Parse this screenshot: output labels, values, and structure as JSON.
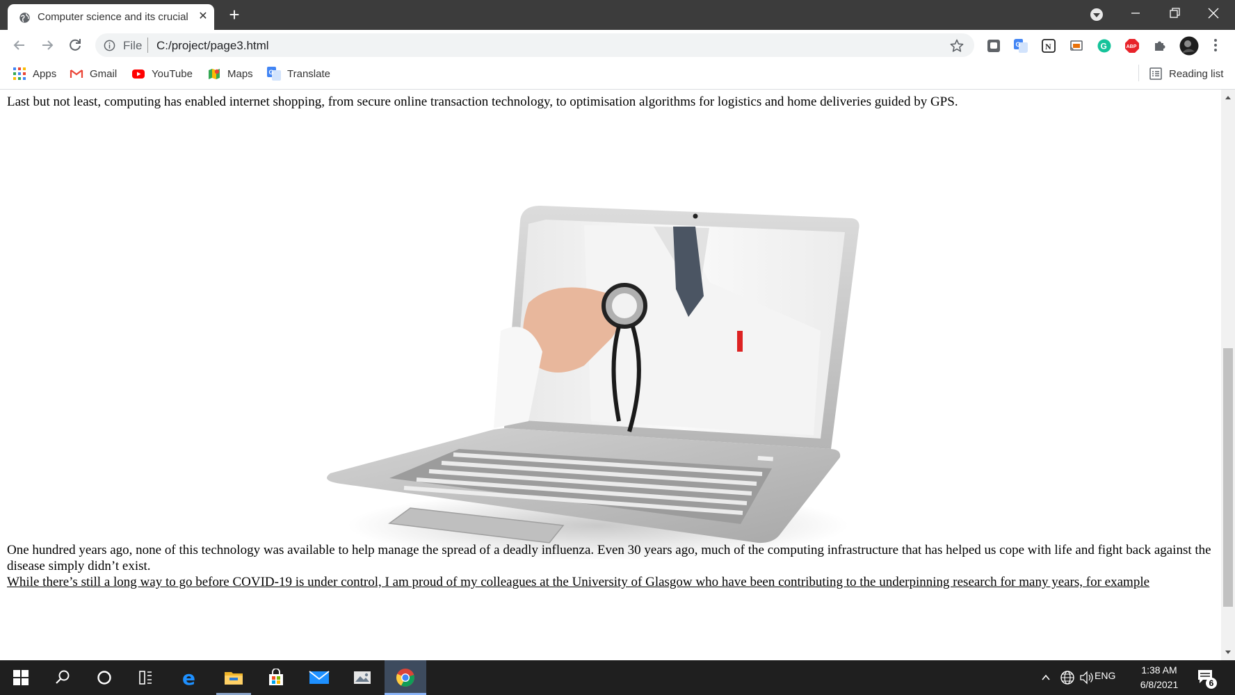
{
  "browser": {
    "tab_title": "Computer science and its crucial",
    "new_tab_symbol": "+",
    "close_symbol": "✕",
    "url_scheme": "File",
    "url_path": "C:/project/page3.html"
  },
  "bookmarks": [
    {
      "label": "Apps",
      "icon": "apps-grid-icon"
    },
    {
      "label": "Gmail",
      "icon": "gmail-icon"
    },
    {
      "label": "YouTube",
      "icon": "youtube-icon"
    },
    {
      "label": "Maps",
      "icon": "maps-icon"
    },
    {
      "label": "Translate",
      "icon": "translate-icon"
    }
  ],
  "reading_list": "Reading list",
  "extensions": [
    "google-translate-icon",
    "notion-icon",
    "cast-icon",
    "grammarly-icon",
    "adblock-plus-icon",
    "extensions-puzzle-icon",
    "profile-avatar"
  ],
  "extension_text": {
    "adblock": "ABP",
    "notion": "N",
    "grammarly": "G"
  },
  "page": {
    "para_top": "Last but not least, computing has enabled internet shopping, from secure online transaction technology, to optimisation algorithms for logistics and home deliveries guided by GPS.",
    "image_subject": "doctor-with-stethoscope-in-laptop",
    "para_bottom_1": "One hundred years ago, none of this technology was available to help manage the spread of a deadly influenza. Even 30 years ago, much of the computing infrastructure that has helped us cope with life and fight back against the disease simply didn’t exist.",
    "para_bottom_2": "While there’s still a long way to go before COVID-19 is under control, I am proud of my colleagues at the University of Glasgow who have been contributing to the underpinning research for many years, for example"
  },
  "taskbar": {
    "lang": "ENG",
    "time": "1:38 AM",
    "date": "6/8/2021",
    "notification_count": "6"
  },
  "colors": {
    "tab_strip": "#3c3c3c",
    "taskbar": "#1f1f1f",
    "chrome_active": "#1a73e8"
  }
}
